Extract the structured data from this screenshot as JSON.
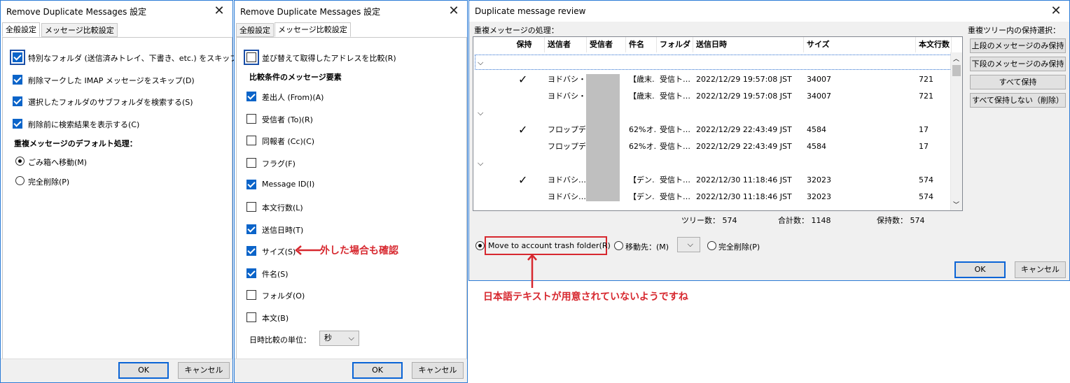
{
  "win1": {
    "title": "Remove Duplicate Messages 設定",
    "tabs": [
      "全般設定",
      "メッセージ比較設定"
    ],
    "options": [
      {
        "label": "特別なフォルダ (送信済みトレイ、下書き、etc.) をスキップ(K)",
        "checked": true
      },
      {
        "label": "削除マークした IMAP メッセージをスキップ(D)",
        "checked": true
      },
      {
        "label": "選択したフォルダのサブフォルダを検索する(S)",
        "checked": true
      },
      {
        "label": "削除前に検索結果を表示する(C)",
        "checked": true
      }
    ],
    "section": "重複メッセージのデフォルト処理：",
    "radios": [
      {
        "label": "ごみ箱へ移動(M)",
        "checked": true
      },
      {
        "label": "完全削除(P)",
        "checked": false
      }
    ],
    "ok": "OK",
    "cancel": "キャンセル"
  },
  "win2": {
    "title": "Remove Duplicate Messages 設定",
    "tabs": [
      "全般設定",
      "メッセージ比較設定"
    ],
    "top_option": {
      "label": "並び替えて取得したアドレスを比較(R)",
      "checked": false
    },
    "section": "比較条件のメッセージ要素",
    "criteria": [
      {
        "label": "差出人 (From)(A)",
        "checked": true
      },
      {
        "label": "受信者 (To)(R)",
        "checked": false
      },
      {
        "label": "同報者 (Cc)(C)",
        "checked": false
      },
      {
        "label": "フラグ(F)",
        "checked": false
      },
      {
        "label": "Message ID(I)",
        "checked": true
      },
      {
        "label": "本文行数(L)",
        "checked": false
      },
      {
        "label": "送信日時(T)",
        "checked": true
      },
      {
        "label": "サイズ(S)",
        "checked": true
      },
      {
        "label": "件名(S)",
        "checked": true
      },
      {
        "label": "フォルダ(O)",
        "checked": false
      },
      {
        "label": "本文(B)",
        "checked": false
      }
    ],
    "time_unit_label": "日時比較の単位：",
    "time_unit_value": "秒",
    "ok": "OK",
    "cancel": "キャンセル",
    "annotation": "外した場合も確認"
  },
  "win3": {
    "title": "Duplicate message review",
    "section": "重複メッセージの処理：",
    "columns": [
      "保持",
      "送信者",
      "受信者",
      "件名",
      "フォルダ",
      "送信日時",
      "サイズ",
      "本文行数"
    ],
    "rows": [
      {
        "type": "group"
      },
      {
        "keep": "✓",
        "sender": "ヨドバシ・…",
        "subject": "【歳末…",
        "folder": "受信ト…",
        "date": "2022/12/29 19:57:08 JST",
        "size": "34007",
        "lines": "721"
      },
      {
        "keep": "",
        "sender": "ヨドバシ・…",
        "subject": "【歳末…",
        "folder": "受信ト…",
        "date": "2022/12/29 19:57:08 JST",
        "size": "34007",
        "lines": "721"
      },
      {
        "type": "group"
      },
      {
        "keep": "✓",
        "sender": "フロップデ…",
        "subject": "62%オ…",
        "folder": "受信ト…",
        "date": "2022/12/29 22:43:49 JST",
        "size": "4584",
        "lines": "17"
      },
      {
        "keep": "",
        "sender": "フロップデ…",
        "subject": "62%オ…",
        "folder": "受信ト…",
        "date": "2022/12/29 22:43:49 JST",
        "size": "4584",
        "lines": "17"
      },
      {
        "type": "group"
      },
      {
        "keep": "✓",
        "sender": "ヨドバシ…",
        "subject": "【デン…",
        "folder": "受信ト…",
        "date": "2022/12/30 11:18:46 JST",
        "size": "32023",
        "lines": "574"
      },
      {
        "keep": "",
        "sender": "ヨドバシ…",
        "subject": "【デン…",
        "folder": "受信ト…",
        "date": "2022/12/30 11:18:46 JST",
        "size": "32023",
        "lines": "574"
      }
    ],
    "side_title": "重複ツリー内の保持選択：",
    "side_buttons": [
      "上段のメッセージのみ保持",
      "下段のメッセージのみ保持",
      "すべて保持",
      "すべて保持しない（削除）"
    ],
    "stats": {
      "tree": "ツリー数： 574",
      "total": "合計数： 1148",
      "keep": "保持数： 574"
    },
    "actions": {
      "trash": "Move to account trash folder(R)",
      "move": "移動先：(M)",
      "delete": "完全削除(P)"
    },
    "ok": "OK",
    "cancel": "キャンセル",
    "annotation": "日本語テキストが用意されていないようですね"
  }
}
